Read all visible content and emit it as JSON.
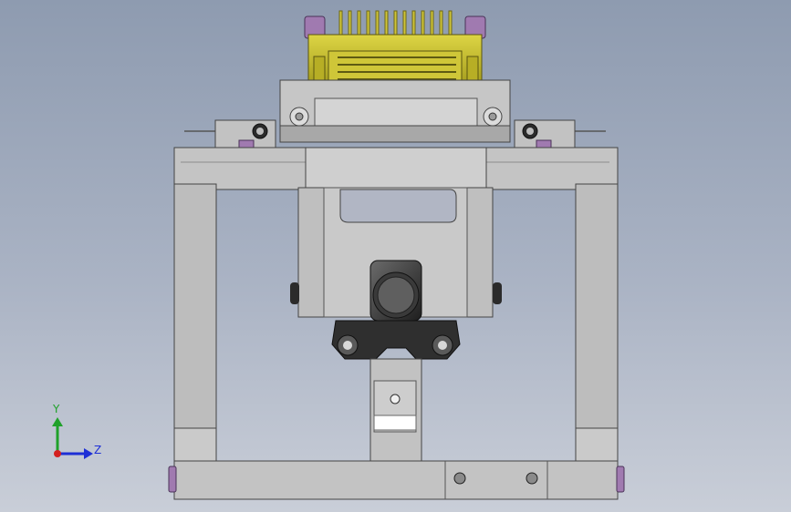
{
  "viewport": {
    "background_top": "#8e9bb0",
    "background_bottom": "#c9ced8"
  },
  "triad": {
    "y_label": "Y",
    "z_label": "Z",
    "y_color": "#1fa12a",
    "z_color": "#1d2fd6",
    "x_color": "#d42020"
  },
  "colors": {
    "frame_gray": "#bdbdbd",
    "frame_dark": "#9d9d9d",
    "connector_yellow": "#c9c12a",
    "connector_dark": "#77711a",
    "cap_purple": "#a07ab0",
    "black_part": "#2b2b2b"
  }
}
